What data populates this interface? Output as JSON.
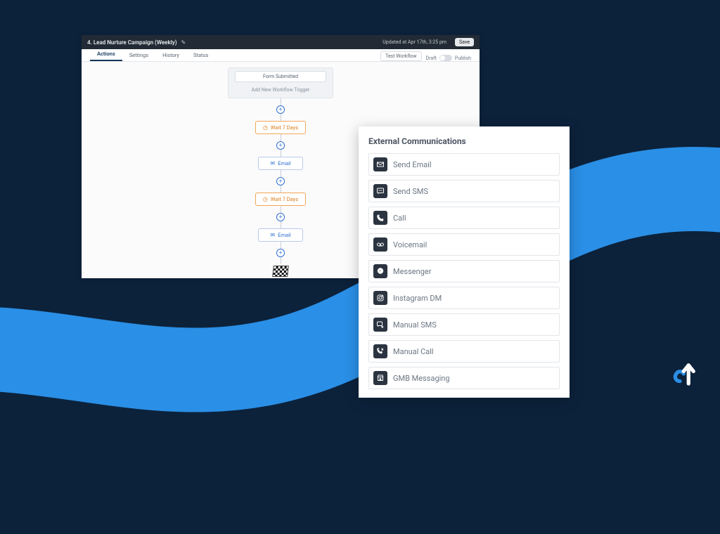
{
  "header": {
    "title": "4. Lead Nurture Campaign (Weekly)",
    "updated": "Updated at Apr 17th, 3:25 pm",
    "save": "Save"
  },
  "tabs": {
    "actions": "Actions",
    "settings": "Settings",
    "history": "History",
    "status": "Status",
    "test": "Test Workflow",
    "draft": "Draft",
    "publish": "Publish"
  },
  "workflow": {
    "trigger": "Form Submitted",
    "add_trigger": "Add New Workflow Trigger",
    "steps": [
      {
        "type": "wait",
        "label": "Wait 7 Days"
      },
      {
        "type": "email",
        "label": "Email"
      },
      {
        "type": "wait",
        "label": "Wait 7 Days"
      },
      {
        "type": "email",
        "label": "Email"
      }
    ]
  },
  "panel": {
    "heading": "External Communications",
    "actions": [
      {
        "icon": "email",
        "label": "Send Email"
      },
      {
        "icon": "sms",
        "label": "Send SMS"
      },
      {
        "icon": "call",
        "label": "Call"
      },
      {
        "icon": "voicemail",
        "label": "Voicemail"
      },
      {
        "icon": "messenger",
        "label": "Messenger"
      },
      {
        "icon": "instagram",
        "label": "Instagram DM"
      },
      {
        "icon": "manualsms",
        "label": "Manual SMS"
      },
      {
        "icon": "manualcall",
        "label": "Manual Call"
      },
      {
        "icon": "gmb",
        "label": "GMB Messaging"
      }
    ]
  }
}
